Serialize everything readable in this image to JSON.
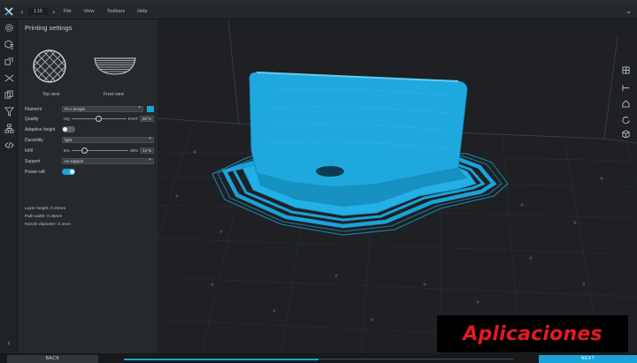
{
  "app": {
    "version": "1.15",
    "accent": "#1aa3d9",
    "menu": [
      "File",
      "View",
      "Toolbars",
      "Help"
    ]
  },
  "panel": {
    "title": "Printing settings",
    "top_view_label": "Top view",
    "front_view_label": "Front view",
    "filament": {
      "label": "Filament",
      "value": "PLA Zesiph"
    },
    "quality": {
      "label": "Quality",
      "min_label": "HQ",
      "max_label": "FAST",
      "value": "50",
      "unit": "%",
      "level": 0.5
    },
    "adaptive_height": {
      "label": "Adaptive height",
      "on": false
    },
    "durability": {
      "label": "Durability",
      "value": "light"
    },
    "infill": {
      "label": "Infill",
      "min_label": "5%",
      "max_label": "35%",
      "value": "12",
      "unit": "%",
      "level": 0.23
    },
    "support": {
      "label": "Support",
      "value": "no support"
    },
    "power_raft": {
      "label": "Power raft",
      "on": true
    },
    "stats": [
      "Layer height: 0.23mm",
      "Path width: 0.46mm",
      "Nozzle diameter: 0.4mm"
    ]
  },
  "footer": {
    "back_label": "BACK",
    "next_label": "NEXT",
    "progress": 0.5
  },
  "watermark": "Aplicaciones",
  "icons": {
    "rail": [
      "gear-icon",
      "cube-list-icon",
      "scale-icon",
      "cut-icon",
      "copy-icon",
      "funnel-icon",
      "tree-icon",
      "code-icon"
    ],
    "viewport_right": [
      "grid-icon",
      "reset-icon",
      "home-icon",
      "rotate-icon",
      "cube-outline-icon"
    ]
  }
}
